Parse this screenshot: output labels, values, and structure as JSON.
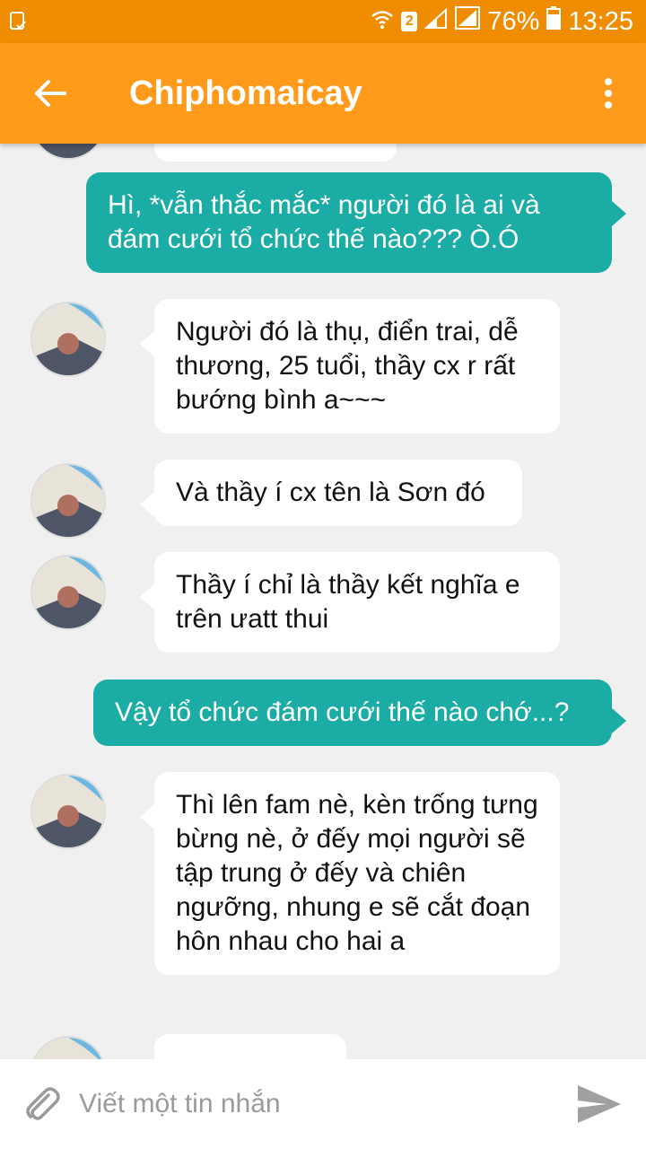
{
  "status_bar": {
    "battery": "76%",
    "time": "13:25",
    "sim": "2"
  },
  "header": {
    "title": "Chiphomaicay"
  },
  "messages": [
    {
      "from": "me",
      "text": "Hì, *vẫn thắc mắc* người đó là ai và đám cưới tổ chức thế nào??? Ò.Ó"
    },
    {
      "from": "them",
      "text": "Người đó là thụ, điển trai, dễ thương, 25 tuổi, thầy cx r rất bướng bình a~~~"
    },
    {
      "from": "them",
      "text": "Và thầy í cx tên là Sơn đó"
    },
    {
      "from": "them",
      "text": "Thầy í chỉ là thầy kết nghĩa e trên ưatt thui"
    },
    {
      "from": "me",
      "text": "Vậy tổ chức đám cưới thế nào chớ...?"
    },
    {
      "from": "them",
      "text": "Thì lên fam nè, kèn trống tưng bừng nè, ở đếy mọi người sẽ tập trung ở đếy và chiên ngưỡng, nhung e sẽ cắt đoạn hôn nhau cho hai a"
    }
  ],
  "composer": {
    "placeholder": "Viết một tin nhắn"
  },
  "colors": {
    "status_bar": "#ef8c00",
    "app_bar": "#ff9a1a",
    "outgoing": "#1aaca5",
    "incoming": "#ffffff",
    "background": "#f0f0f0"
  }
}
